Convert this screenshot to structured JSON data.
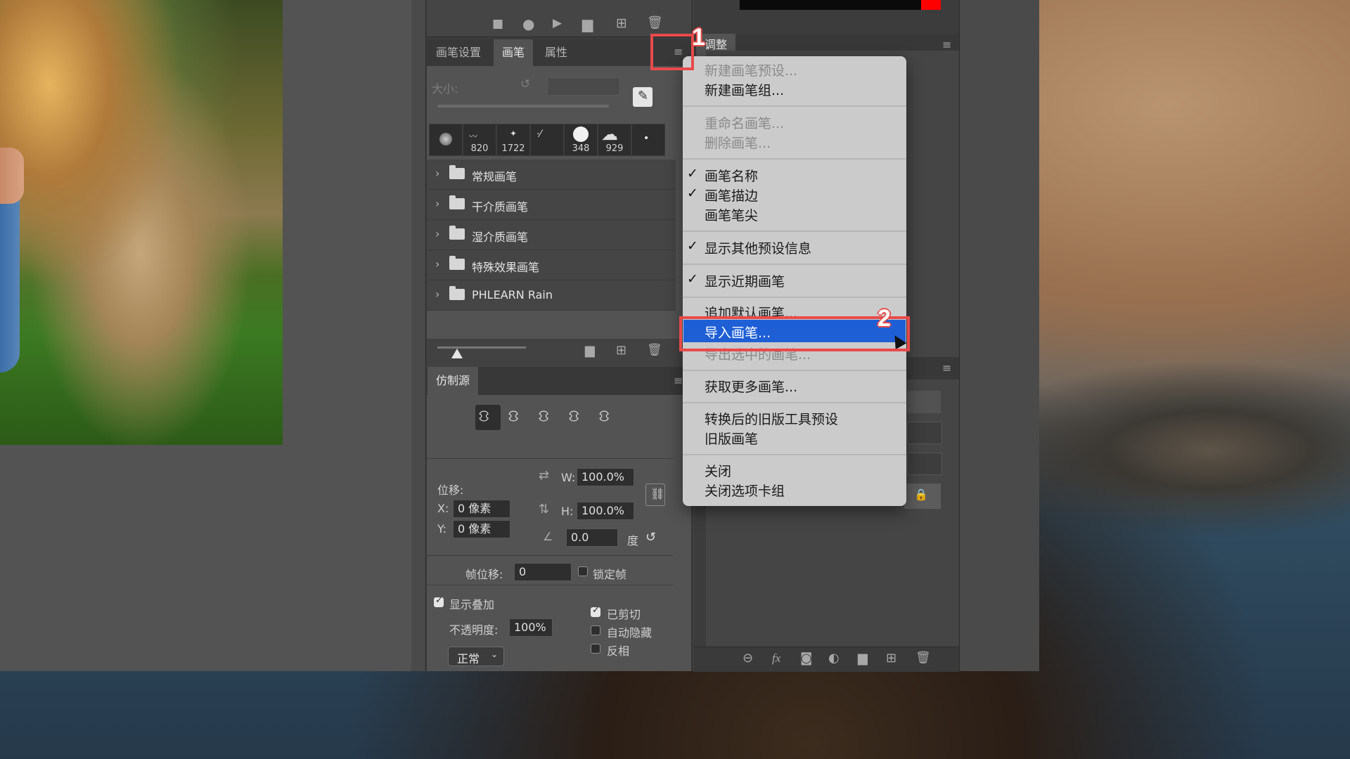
{
  "brush_panel": {
    "tabs": [
      "画笔设置",
      "画笔",
      "属性"
    ],
    "size_label": "大小:",
    "recent_brushes": [
      "820",
      "1722",
      "348",
      "929"
    ],
    "folders": [
      "常规画笔",
      "干介质画笔",
      "湿介质画笔",
      "特殊效果画笔",
      "PHLEARN Rain"
    ]
  },
  "adjust_panel": {
    "tab": "调整"
  },
  "clone_panel": {
    "tab": "仿制源",
    "offset_label": "位移:",
    "x_label": "X:",
    "x_value": "0 像素",
    "y_label": "Y:",
    "y_value": "0 像素",
    "w_label": "W:",
    "w_value": "100.0%",
    "h_label": "H:",
    "h_value": "100.0%",
    "angle_value": "0.0",
    "angle_unit": "度",
    "frame_offset_label": "帧位移:",
    "frame_offset_value": "0",
    "lock_frame_label": "锁定帧",
    "show_overlay_label": "显示叠加",
    "opacity_label": "不透明度:",
    "opacity_value": "100%",
    "clipped_label": "已剪切",
    "auto_hide_label": "自动隐藏",
    "invert_label": "反相",
    "blend_mode": "正常"
  },
  "menu": {
    "items": [
      {
        "label": "新建画笔预设...",
        "disabled": true
      },
      {
        "label": "新建画笔组...",
        "disabled": false
      },
      {
        "label": "重命名画笔...",
        "disabled": true
      },
      {
        "label": "删除画笔...",
        "disabled": true
      },
      {
        "label": "画笔名称",
        "checked": true
      },
      {
        "label": "画笔描边",
        "checked": true
      },
      {
        "label": "画笔笔尖",
        "checked": false
      },
      {
        "label": "显示其他预设信息",
        "checked": true
      },
      {
        "label": "显示近期画笔",
        "checked": true
      },
      {
        "label": "追加默认画笔...",
        "disabled": false
      },
      {
        "label": "导入画笔...",
        "selected": true
      },
      {
        "label": "导出选中的画笔...",
        "disabled": true
      },
      {
        "label": "获取更多画笔...",
        "disabled": false
      },
      {
        "label": "转换后的旧版工具预设",
        "disabled": false
      },
      {
        "label": "旧版画笔",
        "disabled": false
      },
      {
        "label": "关闭",
        "disabled": false
      },
      {
        "label": "关闭选项卡组",
        "disabled": false
      }
    ]
  },
  "annotations": {
    "step1": "1",
    "step2": "2"
  },
  "colors": {
    "highlight": "#1e5fd6",
    "annotation": "#e84a4a",
    "foreground": "#ff0000"
  }
}
